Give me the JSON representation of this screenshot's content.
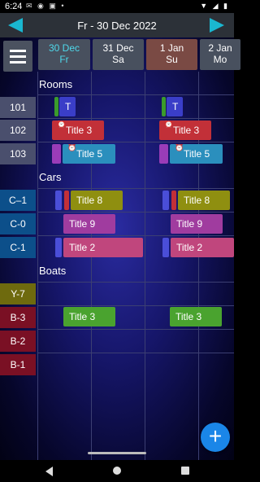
{
  "status": {
    "time": "6:24",
    "left_icons": [
      "message-icon",
      "chat-icon",
      "image-icon",
      "dot"
    ],
    "right_icons": [
      "wifi-icon",
      "cell-signal-icon",
      "battery-icon"
    ]
  },
  "header": {
    "title": "Fr - 30 Dec 2022",
    "prev_icon": "left-arrow",
    "next_icon": "right-arrow"
  },
  "days": [
    {
      "line1": "30 Dec",
      "line2": "Fr"
    },
    {
      "line1": "31 Dec",
      "line2": "Sa"
    },
    {
      "line1": "1 Jan",
      "line2": "Su"
    },
    {
      "line1": "2 Jan",
      "line2": "Mo"
    }
  ],
  "sections": {
    "rooms": "Rooms",
    "cars": "Cars",
    "boats": "Boats"
  },
  "rows": {
    "room_101": "101",
    "room_102": "102",
    "room_103": "103",
    "car_cm1": "C–1",
    "car_c0": "C-0",
    "car_c1": "C-1",
    "boat_y7": "Y-7",
    "boat_b3": "B-3",
    "boat_b2": "B-2",
    "boat_b1": "B-1"
  },
  "events": {
    "t": "T",
    "title3": "Title 3",
    "title5": "Title 5",
    "title8": "Title 8",
    "title9": "Title 9",
    "title2": "Title 2"
  },
  "fab": {
    "label": "+"
  },
  "colors": {
    "accent": "#1ab7d0",
    "fab": "#1a86e8"
  }
}
